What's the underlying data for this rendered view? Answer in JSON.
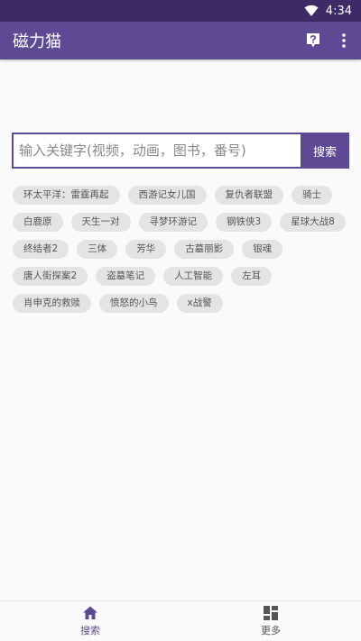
{
  "status_bar": {
    "time": "4:34",
    "wifi_icon": "wifi-icon"
  },
  "app_bar": {
    "title": "磁力猫",
    "help_icon": "help-icon",
    "more_icon": "more-vert-icon"
  },
  "search": {
    "placeholder": "输入关键字(视频，动画，图书，番号)",
    "value": "",
    "button_label": "搜索"
  },
  "tags": [
    "环太平洋：雷霆再起",
    "西游记女儿国",
    "复仇者联盟",
    "骑士",
    "白鹿原",
    "天生一对",
    "寻梦环游记",
    "钢铁侠3",
    "星球大战8",
    "终结者2",
    "三体",
    "芳华",
    "古墓丽影",
    "银魂",
    "唐人街探案2",
    "盗墓笔记",
    "人工智能",
    "左耳",
    "肖申克的救赎",
    "愤怒的小鸟",
    "x战警"
  ],
  "bottom_nav": {
    "items": [
      {
        "label": "搜索",
        "icon": "home-icon",
        "active": true
      },
      {
        "label": "更多",
        "icon": "grid-icon",
        "active": false
      }
    ]
  },
  "colors": {
    "primary": "#5e4a94",
    "status_bar": "#3d2a66",
    "tag_bg": "#e4e4e4"
  }
}
